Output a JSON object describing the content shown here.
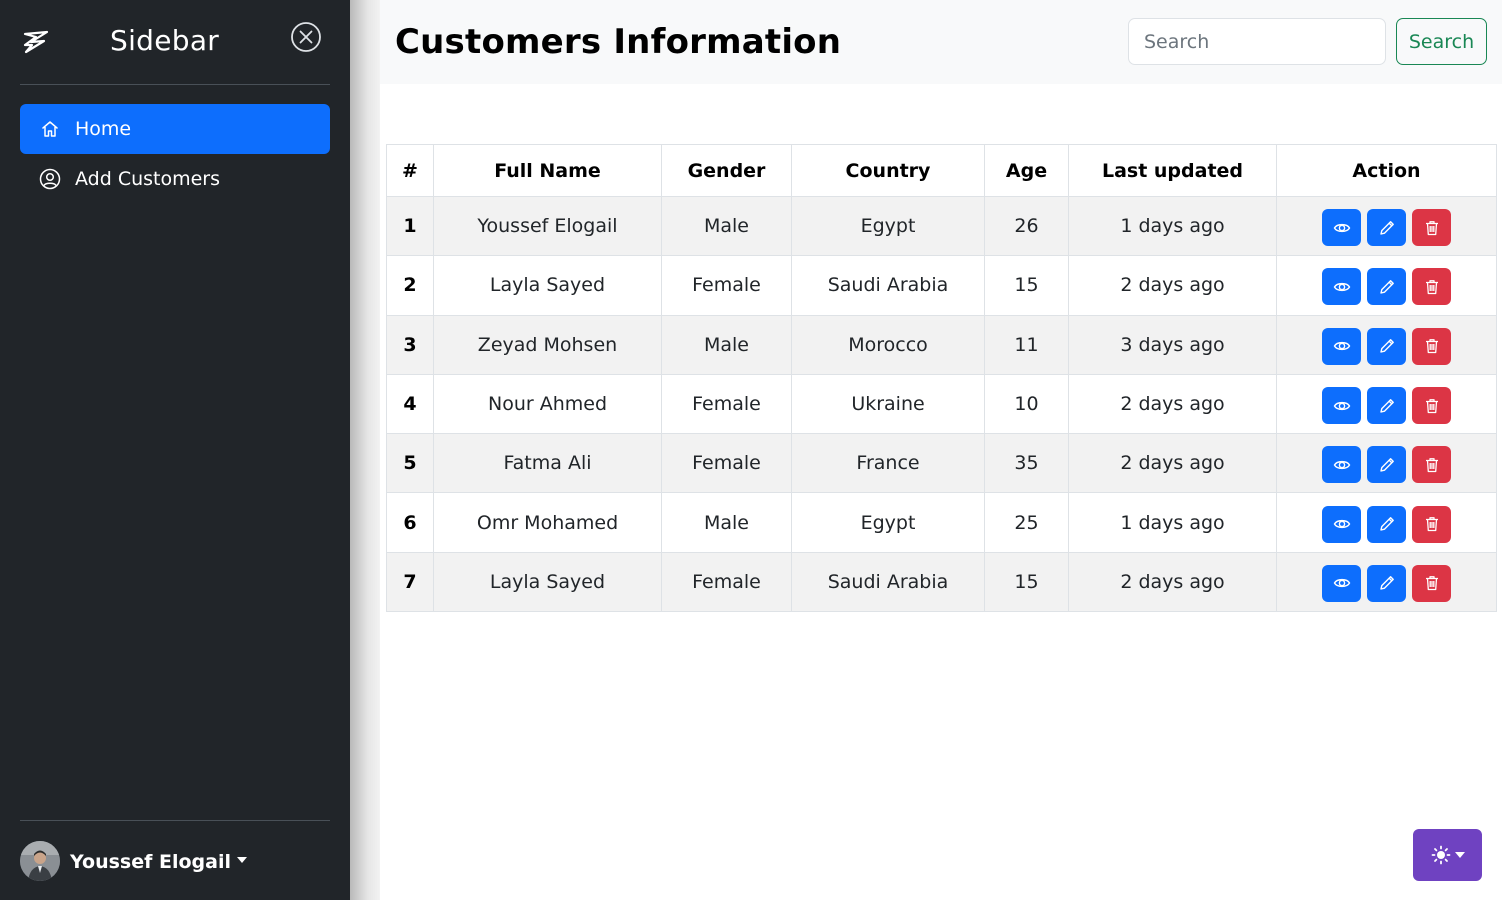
{
  "sidebar": {
    "title": "Sidebar",
    "items": [
      {
        "label": "Home",
        "icon": "home-icon",
        "active": true
      },
      {
        "label": "Add Customers",
        "icon": "user-circle-icon",
        "active": false
      }
    ],
    "user": {
      "name": "Youssef Elogail"
    }
  },
  "header": {
    "title": "Customers Information",
    "search_placeholder": "Search",
    "search_button": "Search"
  },
  "table": {
    "columns": [
      "#",
      "Full Name",
      "Gender",
      "Country",
      "Age",
      "Last updated",
      "Action"
    ],
    "rows": [
      {
        "id": "1",
        "name": "Youssef Elogail",
        "gender": "Male",
        "country": "Egypt",
        "age": "26",
        "updated": "1 days ago"
      },
      {
        "id": "2",
        "name": "Layla Sayed",
        "gender": "Female",
        "country": "Saudi Arabia",
        "age": "15",
        "updated": "2 days ago"
      },
      {
        "id": "3",
        "name": "Zeyad Mohsen",
        "gender": "Male",
        "country": "Morocco",
        "age": "11",
        "updated": "3 days ago"
      },
      {
        "id": "4",
        "name": "Nour Ahmed",
        "gender": "Female",
        "country": "Ukraine",
        "age": "10",
        "updated": "2 days ago"
      },
      {
        "id": "5",
        "name": "Fatma Ali",
        "gender": "Female",
        "country": "France",
        "age": "35",
        "updated": "2 days ago"
      },
      {
        "id": "6",
        "name": "Omr Mohamed",
        "gender": "Male",
        "country": "Egypt",
        "age": "25",
        "updated": "1 days ago"
      },
      {
        "id": "7",
        "name": "Layla Sayed",
        "gender": "Female",
        "country": "Saudi Arabia",
        "age": "15",
        "updated": "2 days ago"
      }
    ]
  },
  "colors": {
    "sidebar_bg": "#212529",
    "primary": "#0d6efd",
    "danger": "#dc3545",
    "success": "#198754",
    "theme_button": "#6f42c1"
  }
}
